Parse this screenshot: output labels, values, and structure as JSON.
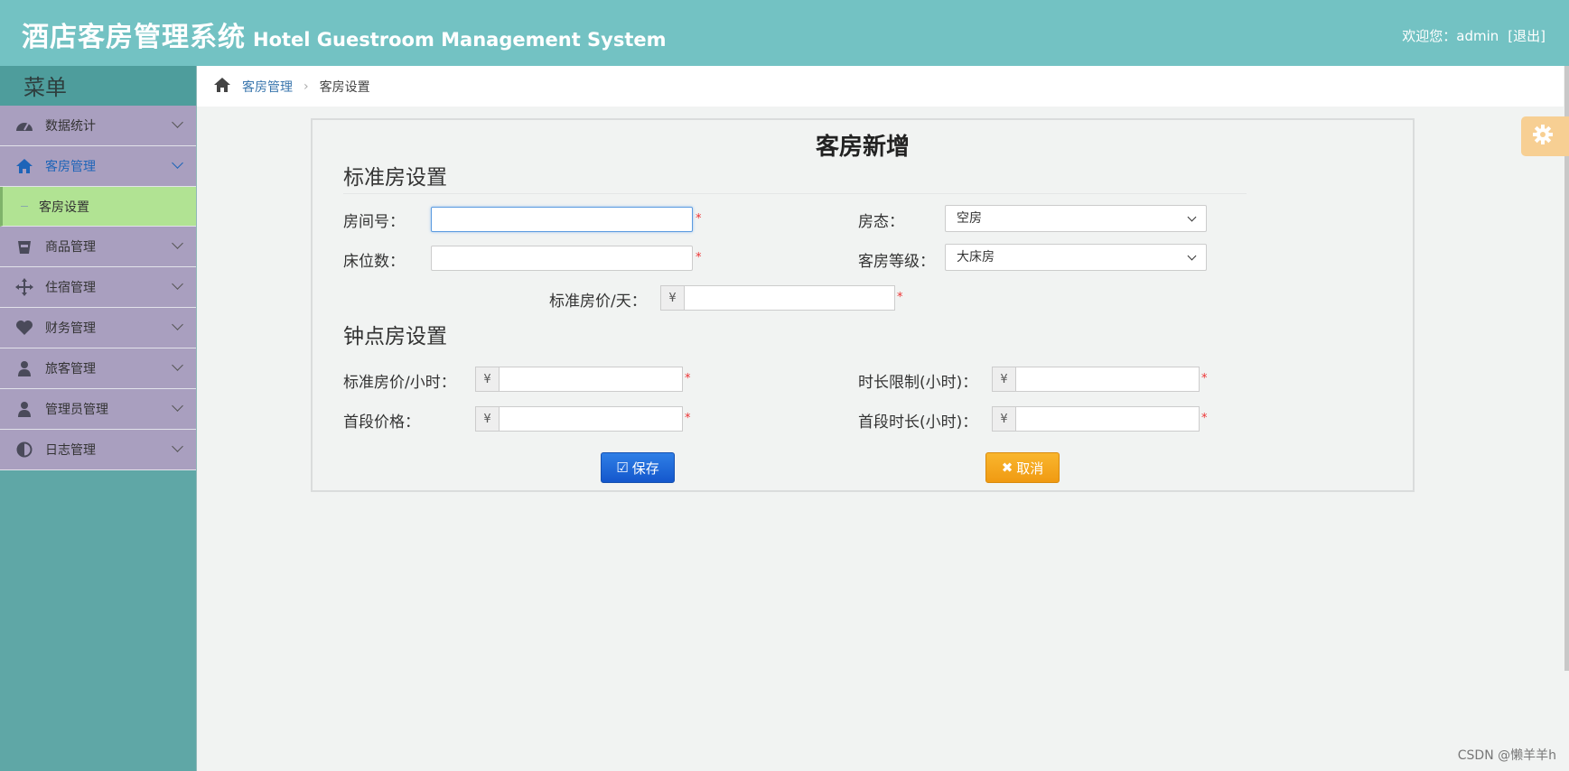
{
  "header": {
    "title_cn": "酒店客房管理系统",
    "title_en": "Hotel Guestroom Management System",
    "welcome": "欢迎您：admin",
    "logout": "[退出]"
  },
  "sidebar": {
    "menu_title": "菜单",
    "items": [
      {
        "label": "数据统计"
      },
      {
        "label": "客房管理"
      },
      {
        "label": "商品管理"
      },
      {
        "label": "住宿管理"
      },
      {
        "label": "财务管理"
      },
      {
        "label": "旅客管理"
      },
      {
        "label": "管理员管理"
      },
      {
        "label": "日志管理"
      }
    ],
    "sub_items": [
      {
        "label": "客房设置"
      }
    ]
  },
  "breadcrumb": {
    "parent": "客房管理",
    "current": "客房设置"
  },
  "form": {
    "title": "客房新增",
    "standard_section": "标准房设置",
    "hourly_section": "钟点房设置",
    "room_no_label": "房间号：",
    "room_no_value": "",
    "room_status_label": "房态：",
    "room_status_value": "空房",
    "beds_label": "床位数：",
    "beds_value": "",
    "room_level_label": "客房等级：",
    "room_level_value": "大床房",
    "std_price_day_label": "标准房价/天：",
    "std_price_hour_label": "标准房价/小时：",
    "time_limit_label": "时长限制(小时)：",
    "first_price_label": "首段价格：",
    "first_duration_label": "首段时长(小时)：",
    "currency": "¥",
    "required_mark": "*"
  },
  "buttons": {
    "save": "保存",
    "cancel": "取消"
  },
  "watermark": "CSDN @懒羊羊h",
  "colors": {
    "header": "#73c2c3",
    "sidebar": "#5fa7a6",
    "nav_item": "#a99fbf",
    "sub_item_active": "#b1e393",
    "save_button": "#1f6bd8",
    "cancel_button": "#f5a81e"
  }
}
